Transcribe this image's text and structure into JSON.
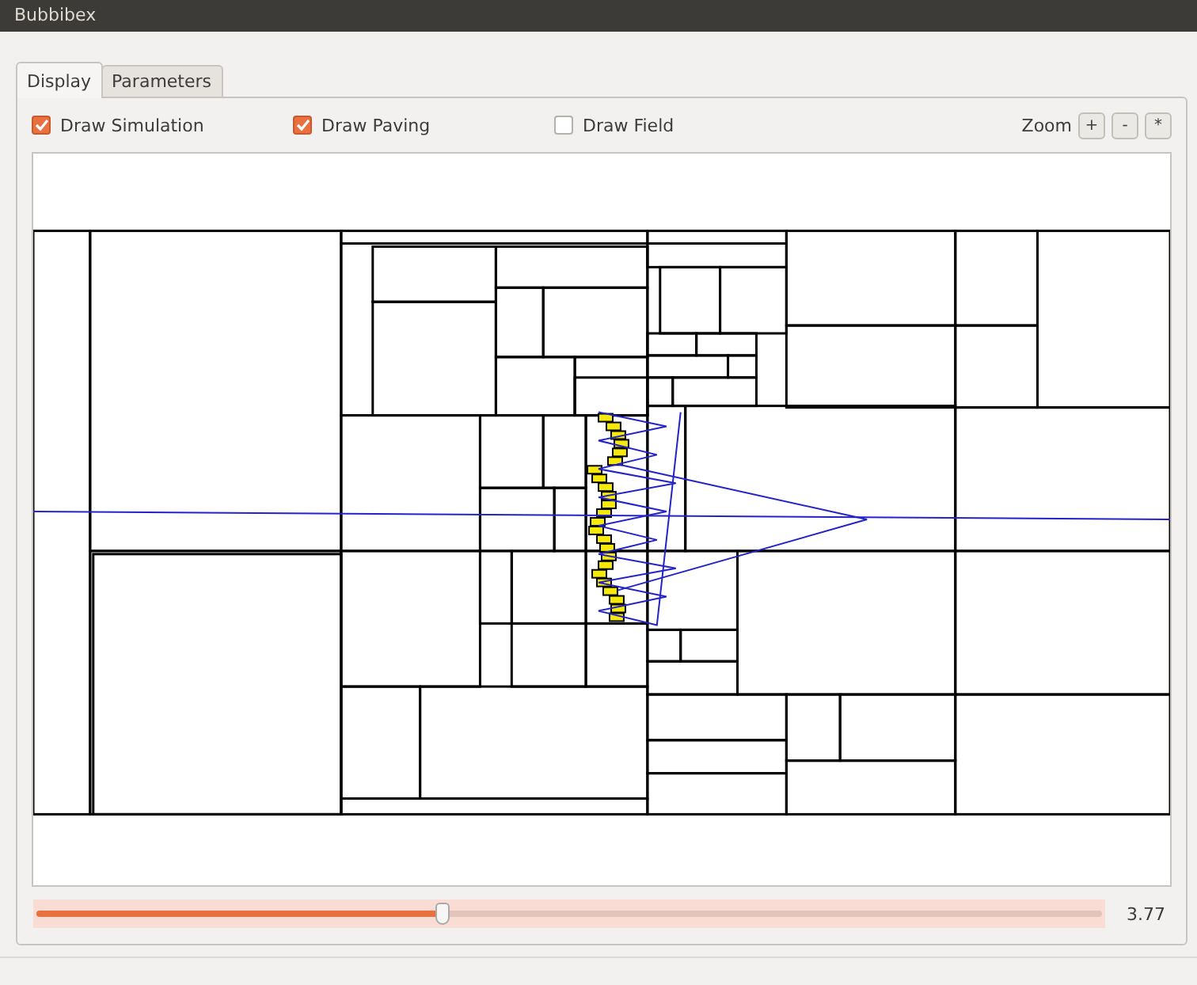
{
  "window": {
    "title": "Bubbibex"
  },
  "tabs": [
    {
      "label": "Display",
      "selected": true
    },
    {
      "label": "Parameters",
      "selected": false
    }
  ],
  "options": [
    {
      "label": "Draw Simulation",
      "checked": true
    },
    {
      "label": "Draw Paving",
      "checked": true
    },
    {
      "label": "Draw Field",
      "checked": false
    }
  ],
  "zoom": {
    "label": "Zoom",
    "buttons": [
      "+",
      "-",
      "*"
    ]
  },
  "time_slider": {
    "level": 0.38,
    "reading": "3.77"
  }
}
